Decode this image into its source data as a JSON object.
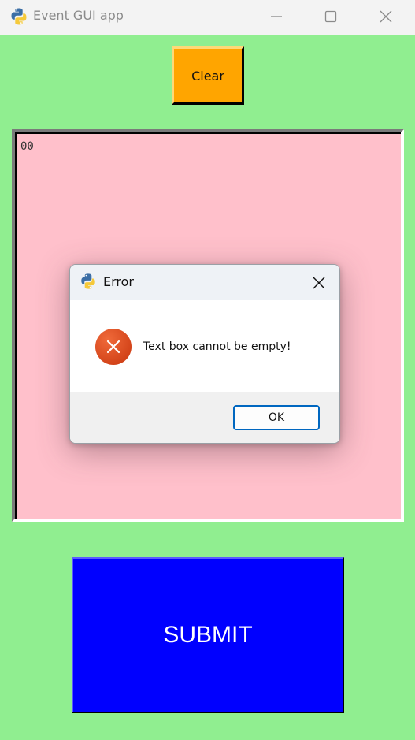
{
  "window": {
    "title": "Event GUI app",
    "icon": "python-icon"
  },
  "main": {
    "clear_label": "Clear",
    "textbox_value": "00",
    "submit_label": "SUBMIT",
    "colors": {
      "background": "#90ee90",
      "clear_button": "#ffa500",
      "textbox": "#ffc0cb",
      "submit_button": "#0000ff"
    }
  },
  "dialog": {
    "title": "Error",
    "icon": "python-icon",
    "message_icon": "error-icon",
    "message": "Text box cannot be empty!",
    "ok_label": "OK"
  }
}
